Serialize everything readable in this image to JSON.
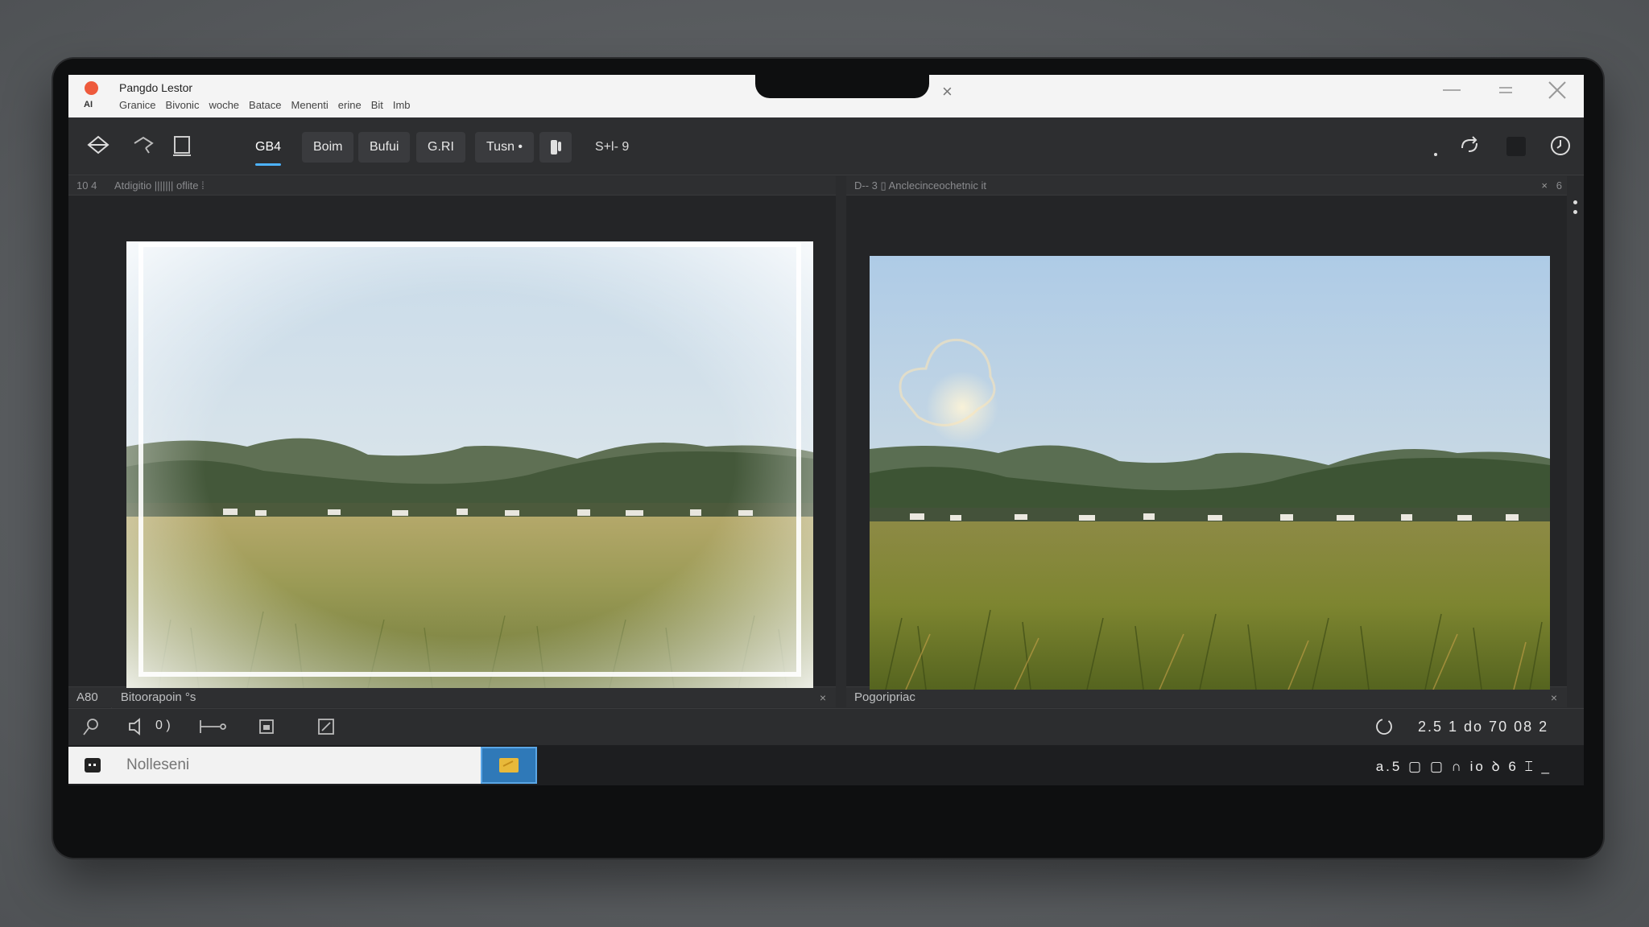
{
  "window": {
    "app_abbr": "AI",
    "title": "Pangdo Lestor",
    "menu": [
      "Granice",
      "Bivonic",
      "woche",
      "Batace",
      "Menenti",
      "erine",
      "Bit",
      "Imb"
    ],
    "tab_close": "×"
  },
  "toolbar": {
    "buttons": [
      "GB4",
      "Boim",
      "Bufui",
      "G.RI",
      "Tusn •"
    ],
    "label": "S+l- 9"
  },
  "panels": {
    "left": {
      "header_prefix": "10 4",
      "header": "Atdigitio ||||||| oflite ⁞",
      "footer_prefix": "A80",
      "footer": "Bitoorapoin °s",
      "footer_close": "×"
    },
    "right": {
      "header": "D-- 3 ▯ Anclecinceochetnic it",
      "header_close": "×",
      "header_extra": "6",
      "footer": "Pogoripriac",
      "footer_close": "×"
    }
  },
  "bottombar": {
    "audio_label": "0 )",
    "readout": "2.5 1 do 70 08 2"
  },
  "statusbar": {
    "search_placeholder": "Nolleseni",
    "status": "a.5 ▢ ▢ ∩ io ꝺ 6 ⌶ _"
  },
  "colors": {
    "accent": "#4db3ff",
    "app_dot": "#ee5a3c",
    "folder": "#e8b93a"
  },
  "icons": {
    "left_tools": [
      "diamond-icon",
      "bucket-icon",
      "lasso-icon",
      "eraser-icon",
      "hourglass-icon",
      "bell-icon",
      "camera-icon",
      "color-wheel-icon",
      "stamp-icon",
      "pen-icon",
      "minus-circle-icon"
    ]
  }
}
